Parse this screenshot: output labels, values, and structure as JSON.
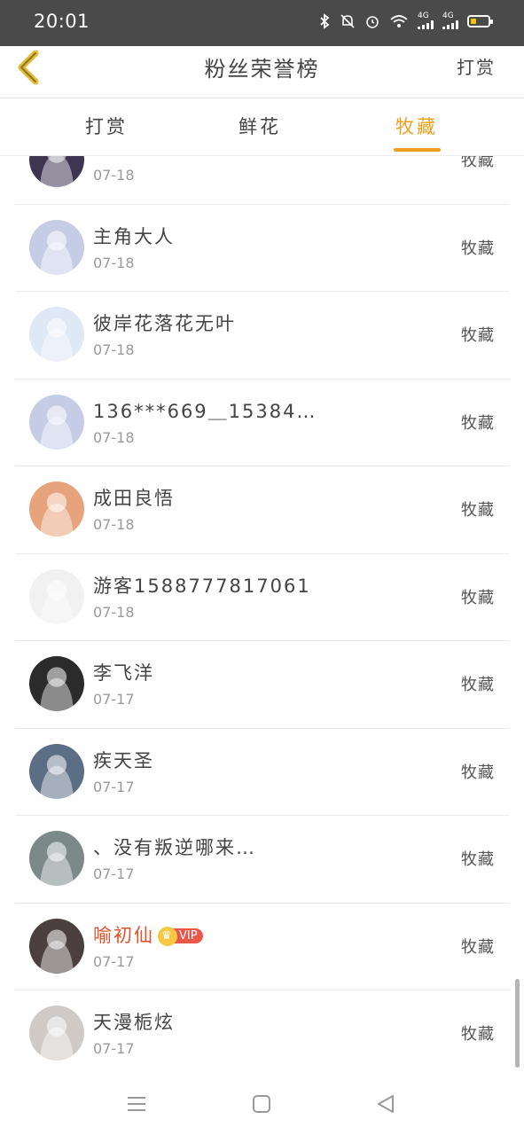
{
  "status_bar": {
    "time": "20:01",
    "network_1": "4G",
    "network_2": "4G",
    "icons": [
      "bluetooth-icon",
      "bell-off-icon",
      "alarm-icon",
      "wifi-icon",
      "signal-icon",
      "signal-icon",
      "battery-icon"
    ]
  },
  "header": {
    "title": "粉丝荣誉榜",
    "right_action": "打赏"
  },
  "tabs": [
    {
      "label": "打赏",
      "active": false
    },
    {
      "label": "鲜花",
      "active": false
    },
    {
      "label": "牧藏",
      "active": true
    }
  ],
  "list": [
    {
      "name": "",
      "date": "07-18",
      "action": "牧藏",
      "avatar_color": "#3d3552",
      "vip": false
    },
    {
      "name": "主角大人",
      "date": "07-18",
      "action": "牧藏",
      "avatar_color": "#c7cce6",
      "vip": false
    },
    {
      "name": "彼岸花落花无叶",
      "date": "07-18",
      "action": "牧藏",
      "avatar_color": "#dfe8f5",
      "vip": false
    },
    {
      "name": "136***669＿15384…",
      "date": "07-18",
      "action": "牧藏",
      "avatar_color": "#c7cce6",
      "vip": false
    },
    {
      "name": "成田良悟",
      "date": "07-18",
      "action": "牧藏",
      "avatar_color": "#e7a37b",
      "vip": false
    },
    {
      "name": "游客1588777817061",
      "date": "07-18",
      "action": "牧藏",
      "avatar_color": "#f1f1f1",
      "vip": false
    },
    {
      "name": "李飞洋",
      "date": "07-17",
      "action": "牧藏",
      "avatar_color": "#2b2b2b",
      "vip": false
    },
    {
      "name": "疾天圣",
      "date": "07-17",
      "action": "牧藏",
      "avatar_color": "#5b6e86",
      "vip": false
    },
    {
      "name": "、没有叛逆哪来…",
      "date": "07-17",
      "action": "牧藏",
      "avatar_color": "#7b8a88",
      "vip": false
    },
    {
      "name": "喻初仙",
      "date": "07-17",
      "action": "牧藏",
      "avatar_color": "#4b3f3f",
      "vip": true,
      "vip_label": "VIP"
    },
    {
      "name": "天漫栀炫",
      "date": "07-17",
      "action": "牧藏",
      "avatar_color": "#cfcac5",
      "vip": false
    }
  ],
  "colors": {
    "accent": "#f0a020",
    "vip_name": "#e2532b",
    "status_bar_bg": "#4a4a4a"
  }
}
